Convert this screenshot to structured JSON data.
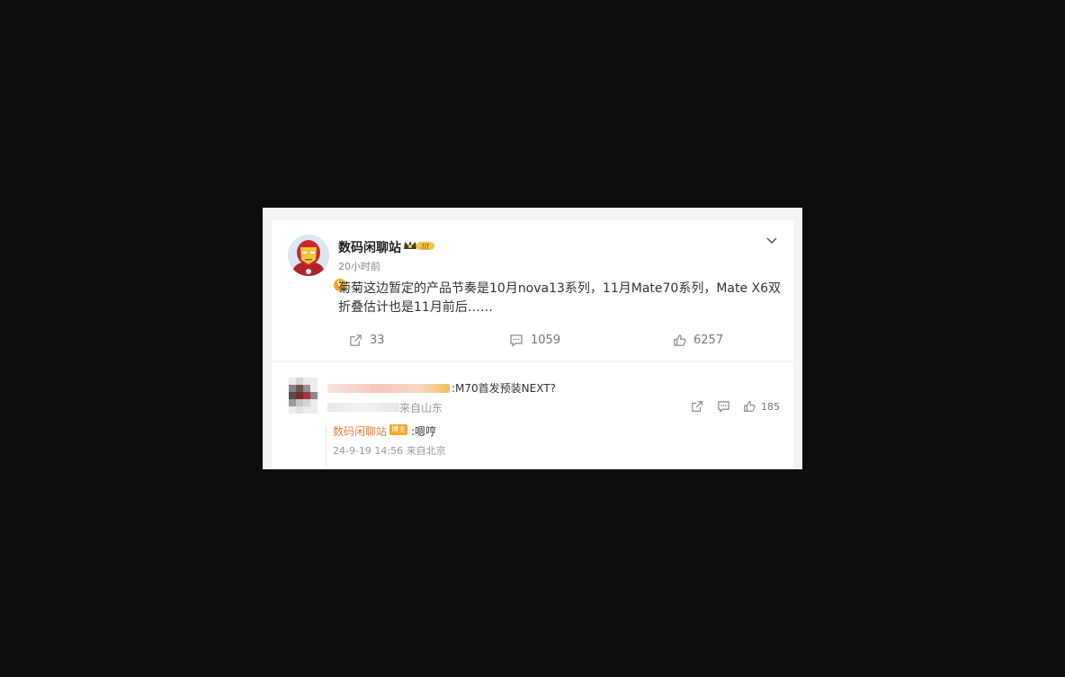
{
  "post": {
    "author": "数码闲聊站",
    "rank_badge": "III",
    "verified_mark": "V",
    "time": "20小时前",
    "text": "菊菊这边暂定的产品节奏是10月nova13系列，11月Mate70系列，Mate X6双折叠估计也是11月前后……",
    "actions": {
      "share_icon": "share-icon",
      "share_count": "33",
      "comment_icon": "comment-icon",
      "comment_count": "1059",
      "like_icon": "thumbs-up-icon",
      "like_count": "6257"
    },
    "menu_icon": "chevron-down-icon"
  },
  "comment": {
    "text": ":M70首发预装NEXT?",
    "location": "来自山东",
    "like_count": "185"
  },
  "reply": {
    "author": "数码闲聊站",
    "badge": "博主",
    "text": ":嗯哼",
    "meta": "24-9-19 14:56 来自北京"
  },
  "colors": {
    "page_background": "#0e0e0e",
    "card_background": "#ffffff",
    "reply_author": "#e0823d",
    "badge": "#f6a623"
  }
}
